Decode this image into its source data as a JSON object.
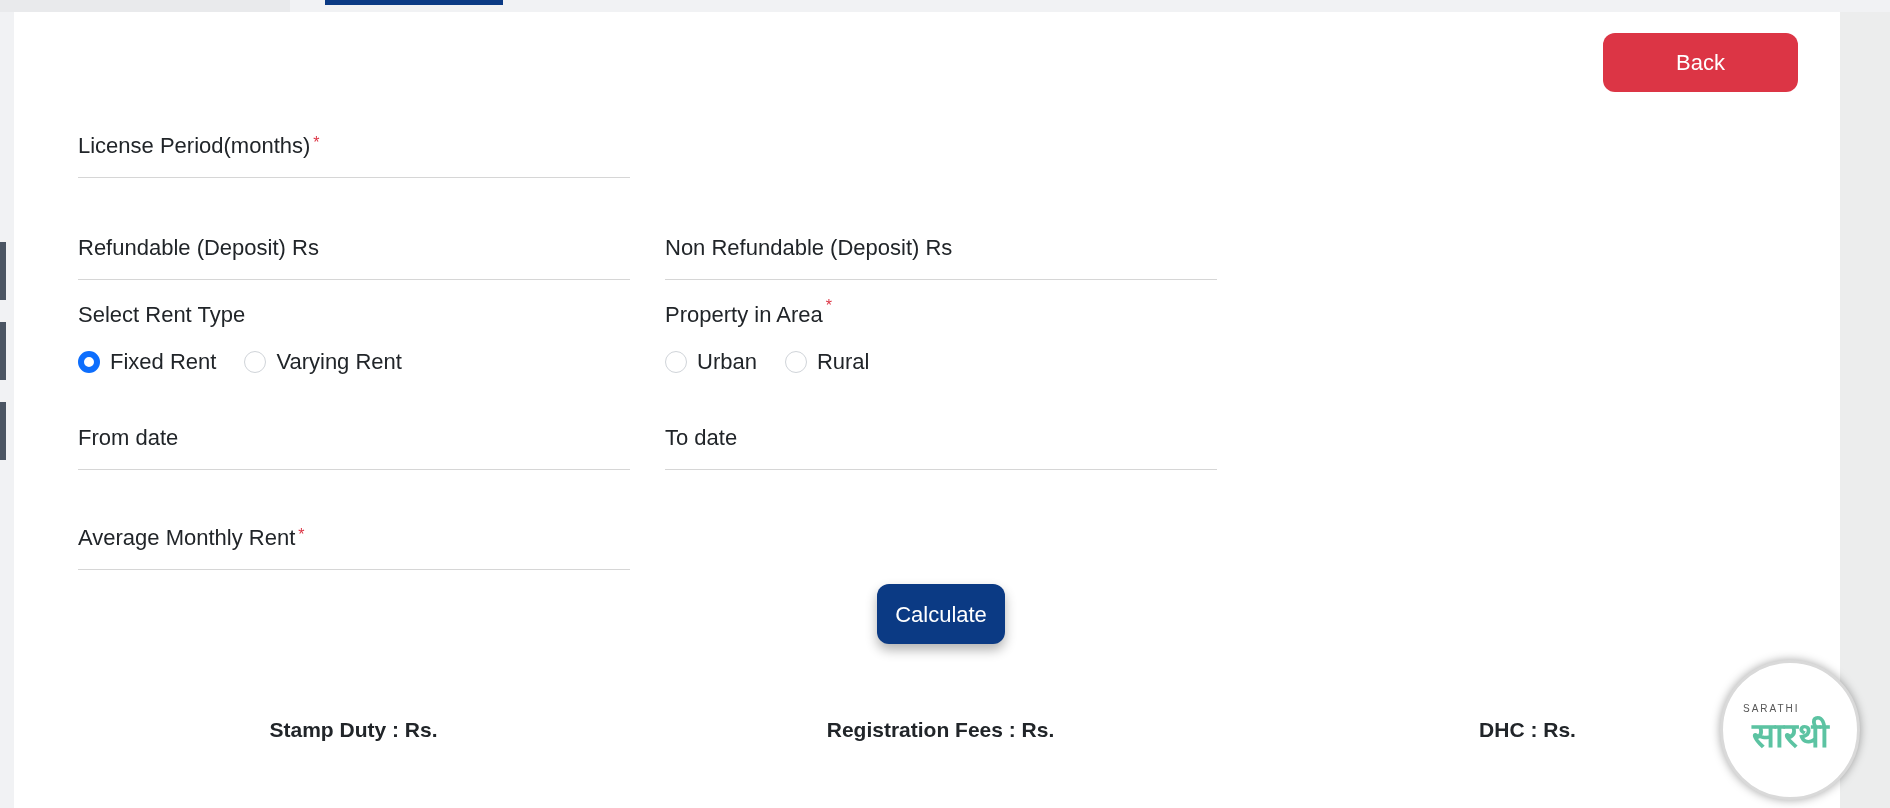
{
  "back_button": "Back",
  "fields": [
    {
      "label": "License Period(months)",
      "required_mark": "*"
    },
    {
      "label": "Refundable (Deposit) Rs"
    },
    {
      "label": "Non Refundable (Deposit) Rs"
    }
  ],
  "radio_groups": [
    {
      "label": "Select Rent Type",
      "options": [
        {
          "label": "Fixed Rent",
          "selected": true
        },
        {
          "label": "Varying Rent",
          "selected": false
        }
      ]
    },
    {
      "label": "Property in Area",
      "required_mark": "*",
      "options": [
        {
          "label": "Urban",
          "selected": false
        },
        {
          "label": "Rural",
          "selected": false
        }
      ]
    }
  ],
  "date_fields": [
    {
      "label": "From date"
    },
    {
      "label": "To date"
    }
  ],
  "rent_field": {
    "label": "Average Monthly Rent",
    "required_mark": "*"
  },
  "calculate_button": "Calculate",
  "results": [
    "Stamp Duty : Rs.",
    "Registration Fees : Rs.",
    "DHC : Rs."
  ],
  "logo": {
    "caption": "SARATHI",
    "script": "सारथी"
  }
}
